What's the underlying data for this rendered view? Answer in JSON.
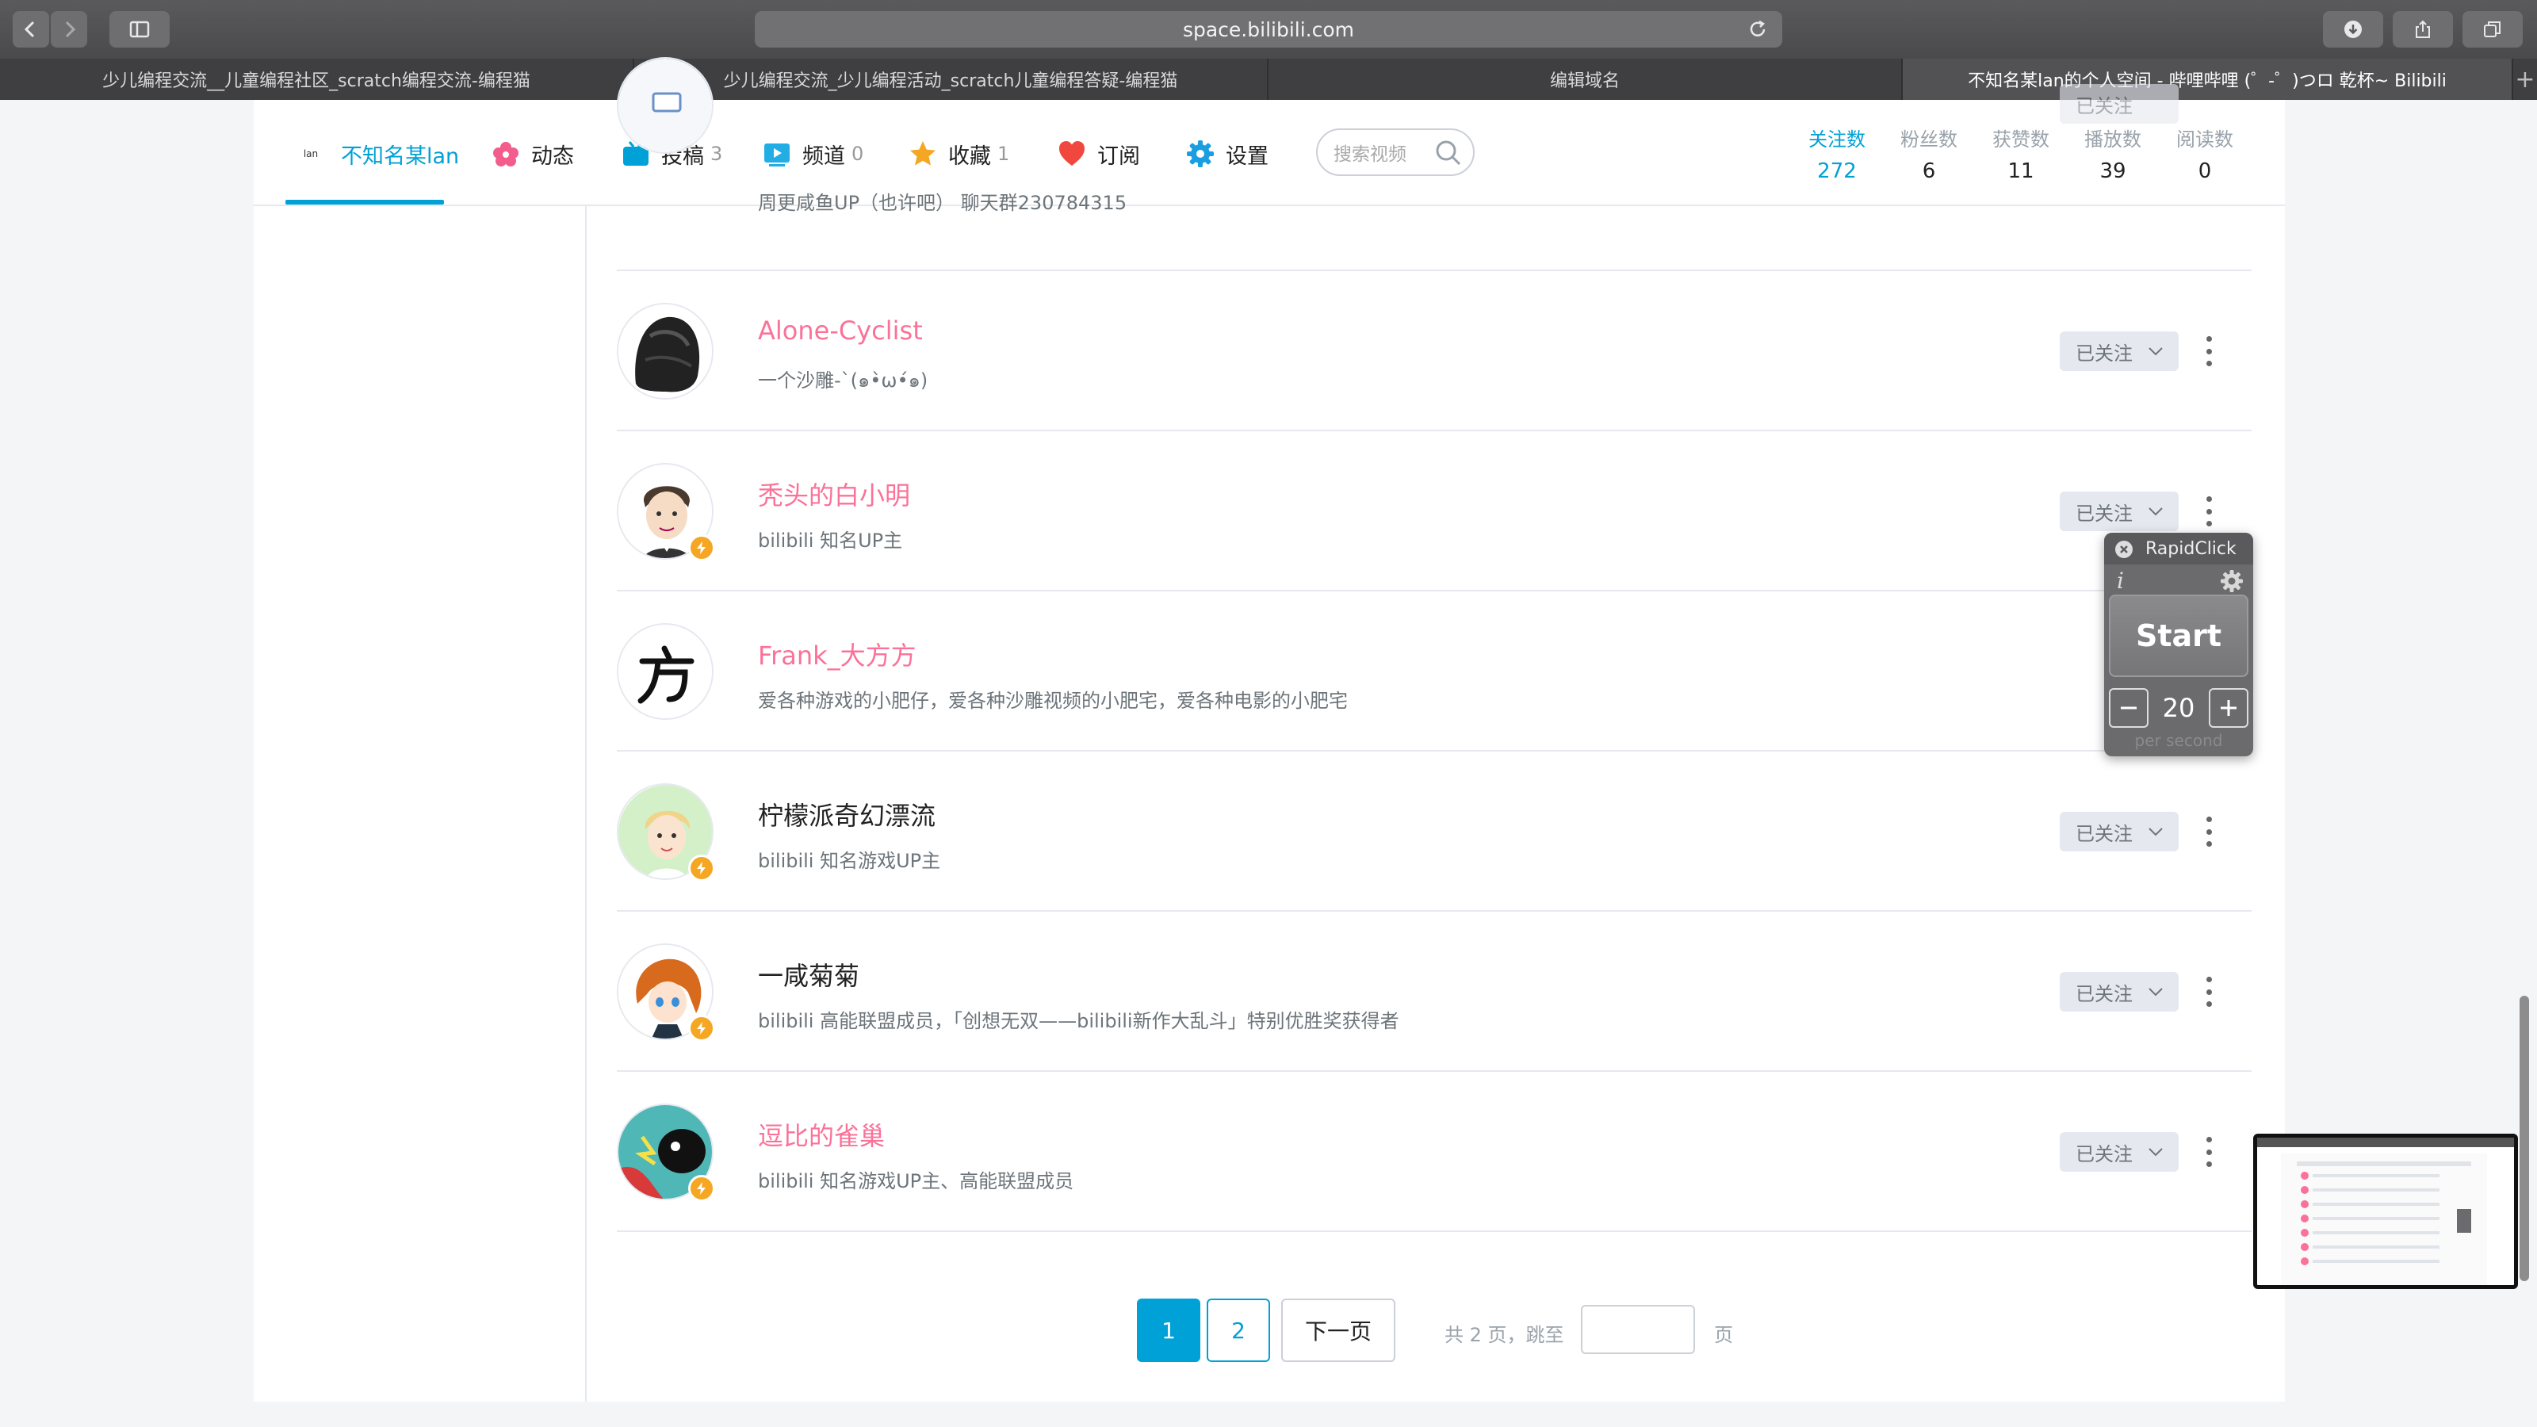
{
  "browser": {
    "address": "space.bilibili.com",
    "tabs": [
      {
        "title": "少儿编程交流__儿童编程社区_scratch编程交流-编程猫",
        "active": false
      },
      {
        "title": "少儿编程交流_少儿编程活动_scratch儿童编程答疑-编程猫",
        "active": false
      },
      {
        "title": "编辑域名",
        "active": false
      },
      {
        "title": "不知名某lan的个人空间 - 哔哩哔哩 (゜-゜)つロ 乾杯~ Bilibili",
        "active": true
      }
    ]
  },
  "nav": {
    "user": "不知名某lan",
    "logo_text": "lan",
    "items": [
      {
        "label": "动态",
        "count": ""
      },
      {
        "label": "投稿",
        "count": "3"
      },
      {
        "label": "频道",
        "count": "0"
      },
      {
        "label": "收藏",
        "count": "1"
      },
      {
        "label": "订阅",
        "count": ""
      },
      {
        "label": "设置",
        "count": ""
      }
    ],
    "search_placeholder": "搜索视频",
    "stats": [
      {
        "label": "关注数",
        "value": "272"
      },
      {
        "label": "粉丝数",
        "value": "6"
      },
      {
        "label": "获赞数",
        "value": "11"
      },
      {
        "label": "播放数",
        "value": "39"
      },
      {
        "label": "阅读数",
        "value": "0"
      }
    ]
  },
  "follow_list": {
    "button_label": "已关注",
    "rows": [
      {
        "name": "",
        "sign": "周更咸鱼UP（也许吧） 聊天群230784315",
        "pink": false,
        "badge": false
      },
      {
        "name": "Alone-Cyclist",
        "sign": "一个沙雕-`(๑•̀ω•́๑)",
        "pink": true,
        "badge": false
      },
      {
        "name": "秃头的白小明",
        "sign": "bilibili 知名UP主",
        "pink": true,
        "badge": true
      },
      {
        "name": "Frank_大方方",
        "sign": "爱各种游戏的小肥仔，爱各种沙雕视频的小肥宅，爱各种电影的小肥宅",
        "pink": true,
        "badge": false
      },
      {
        "name": "柠檬派奇幻漂流",
        "sign": "bilibili 知名游戏UP主",
        "pink": false,
        "badge": true
      },
      {
        "name": "一咸菊菊",
        "sign": "bilibili 高能联盟成员，「创想无双——bilibili新作大乱斗」特别优胜奖获得者",
        "pink": false,
        "badge": true
      },
      {
        "name": "逗比的雀巢",
        "sign": "bilibili 知名游戏UP主、高能联盟成员",
        "pink": true,
        "badge": true
      }
    ]
  },
  "pagination": {
    "current": "1",
    "page2": "2",
    "next": "下一页",
    "total_text": "共 2 页，跳至",
    "unit": "页"
  },
  "rapidclick": {
    "title": "RapidClick",
    "info": "i",
    "start": "Start",
    "value": "20",
    "unit": "per second"
  }
}
